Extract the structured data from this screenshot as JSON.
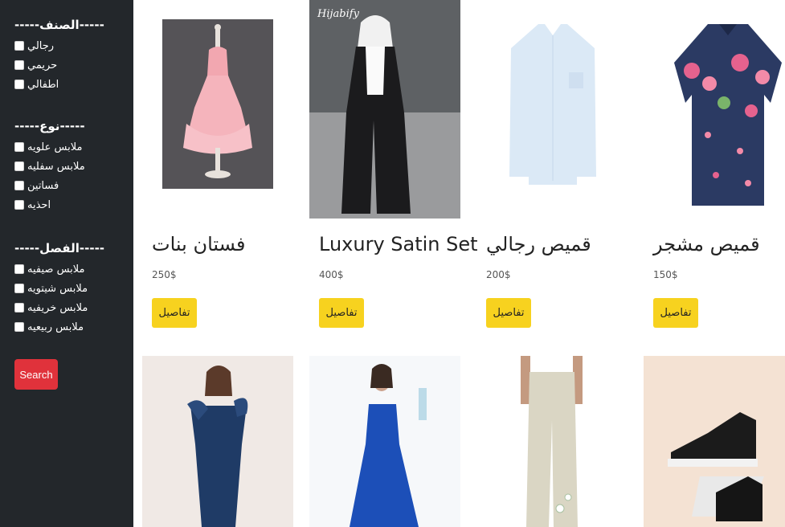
{
  "sidebar": {
    "sections": [
      {
        "title": "-----الصنف-----",
        "items": [
          "رجالي",
          "حريمي",
          "اطفالي"
        ]
      },
      {
        "title": "-----نوع-----",
        "items": [
          "ملابس علويه",
          "ملابس سفليه",
          "فساتين",
          "احذيه"
        ]
      },
      {
        "title": "-----الفصل-----",
        "items": [
          "ملابس صيفيه",
          "ملابس شيتويه",
          "ملابس خريفيه",
          "ملابس ربيعيه"
        ]
      }
    ],
    "search_label": "Search"
  },
  "products": [
    {
      "name": "فستان بنات",
      "price": "250$",
      "button": "تفاصيل",
      "image_icon": "pink-dress-image"
    },
    {
      "name": "Luxury Satin Set",
      "price": "400$",
      "button": "تفاصيل",
      "image_icon": "abaya-model-image",
      "watermark": "Hijabify"
    },
    {
      "name": "قميص رجالي",
      "price": "200$",
      "button": "تفاصيل",
      "image_icon": "white-shirt-image"
    },
    {
      "name": "قميص مشجر",
      "price": "150$",
      "button": "تفاصيل",
      "image_icon": "floral-shirt-image"
    }
  ],
  "second_row": [
    {
      "image_icon": "navy-dress-image"
    },
    {
      "image_icon": "blue-pleated-dress-image"
    },
    {
      "image_icon": "linen-pants-image"
    },
    {
      "image_icon": "sneakers-image"
    }
  ],
  "colors": {
    "sidebar_bg": "#23272b",
    "search_button": "#e0323b",
    "details_button": "#f7d21f"
  }
}
